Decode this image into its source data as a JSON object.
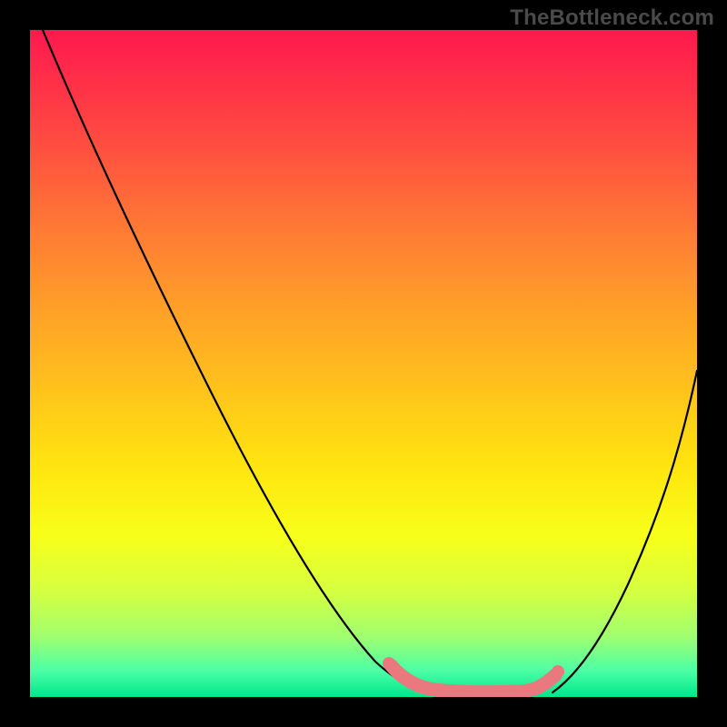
{
  "watermark": "TheBottleneck.com",
  "chart_data": {
    "type": "line",
    "title": "",
    "xlabel": "",
    "ylabel": "",
    "xlim": [
      0,
      100
    ],
    "ylim": [
      0,
      100
    ],
    "grid": false,
    "note": "Values are approximate percentages read from the figure; x = horizontal position across the gradient, y = curve height (100 = top of colored area, 0 = bottom).",
    "series": [
      {
        "name": "left-curve",
        "x": [
          2,
          10,
          20,
          30,
          40,
          48,
          52,
          56,
          60
        ],
        "y": [
          100,
          82,
          63,
          44,
          25,
          9,
          4,
          2,
          1
        ]
      },
      {
        "name": "right-curve",
        "x": [
          78,
          82,
          86,
          90,
          94,
          98,
          100
        ],
        "y": [
          1,
          5,
          12,
          22,
          33,
          44,
          49
        ]
      },
      {
        "name": "optimal-band",
        "style": "thick-pink",
        "x": [
          54,
          56,
          58,
          60,
          64,
          68,
          72,
          74,
          76,
          78
        ],
        "y": [
          4.5,
          2.8,
          1.8,
          1.2,
          1.0,
          1.0,
          1.0,
          1.2,
          2.2,
          4.5
        ]
      }
    ],
    "colors": {
      "curve": "#000000",
      "optimal_band": "#e9787f",
      "gradient_top": "#ff1a4d",
      "gradient_bottom": "#00e68c"
    }
  }
}
